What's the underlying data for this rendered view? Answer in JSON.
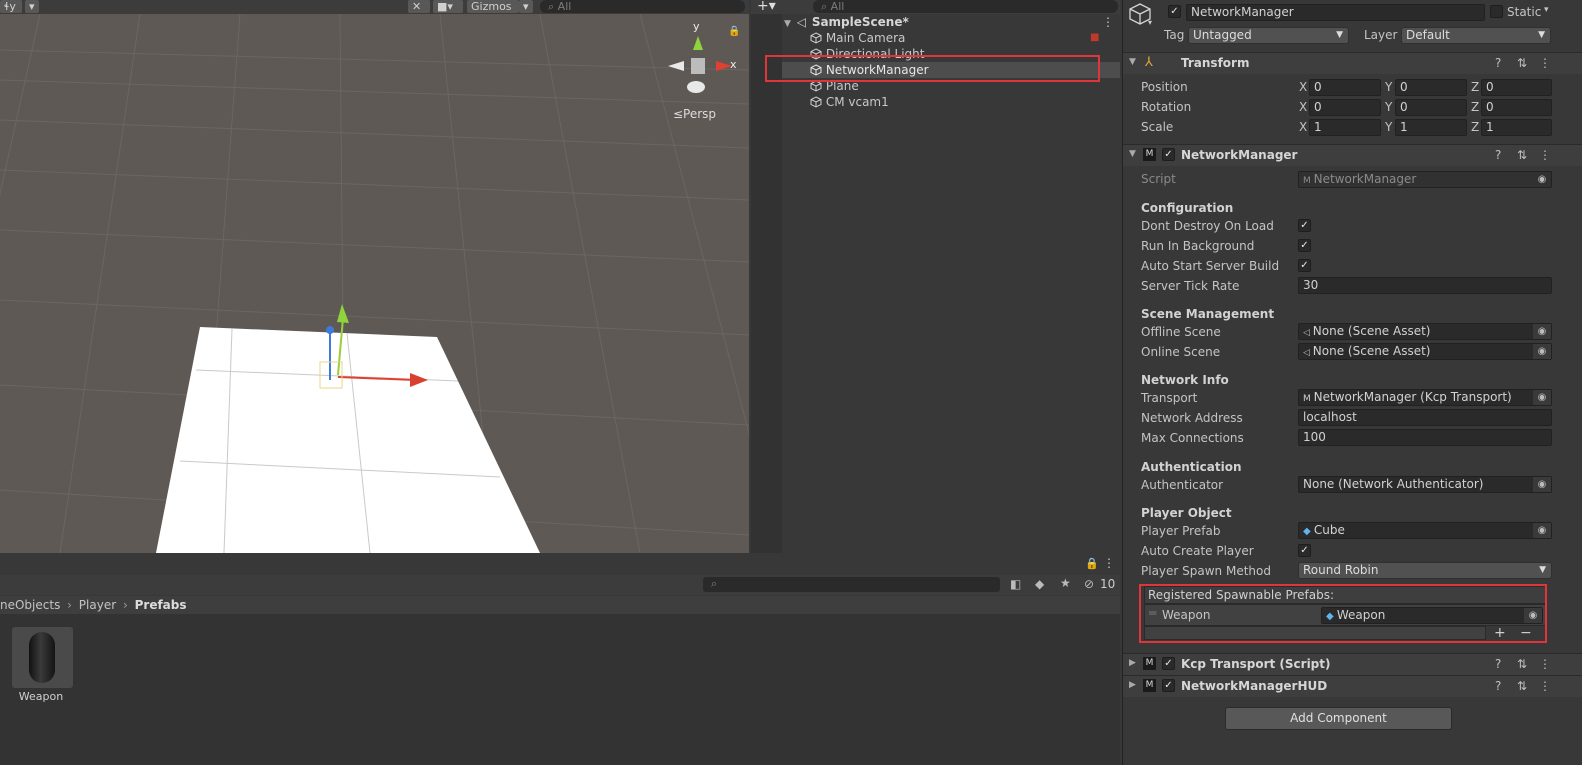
{
  "scene_view": {
    "toolbar": {
      "left_btn": "ɬy",
      "gizmos_label": "Gizmos",
      "search_placeholder": "All"
    },
    "gizmo_axes": {
      "y": "y",
      "x": "x"
    },
    "persp_label": "≤Persp"
  },
  "hierarchy": {
    "search_placeholder": "All",
    "scene_name": "SampleScene*",
    "items": [
      {
        "label": "Main Camera"
      },
      {
        "label": "Directional Light"
      },
      {
        "label": "NetworkManager"
      },
      {
        "label": "Plane"
      },
      {
        "label": "CM vcam1"
      }
    ]
  },
  "project": {
    "breadcrumb": {
      "part1": "neObjects",
      "part2": "Player",
      "part3": "Prefabs"
    },
    "hidden_count": "10",
    "assets": [
      {
        "label": "Weapon"
      }
    ]
  },
  "inspector": {
    "object_name": "NetworkManager",
    "static_label": "Static",
    "tag_label": "Tag",
    "tag_value": "Untagged",
    "layer_label": "Layer",
    "layer_value": "Default",
    "transform": {
      "title": "Transform",
      "position_label": "Position",
      "rotation_label": "Rotation",
      "scale_label": "Scale",
      "position": {
        "x": "0",
        "y": "0",
        "z": "0"
      },
      "rotation": {
        "x": "0",
        "y": "0",
        "z": "0"
      },
      "scale": {
        "x": "1",
        "y": "1",
        "z": "1"
      }
    },
    "network_manager": {
      "title": "NetworkManager",
      "script_label": "Script",
      "script_value": "NetworkManager",
      "configuration": "Configuration",
      "dont_destroy": "Dont Destroy On Load",
      "run_in_bg": "Run In Background",
      "auto_start": "Auto Start Server Build",
      "tick_rate_label": "Server Tick Rate",
      "tick_rate": "30",
      "scene_mgmt": "Scene Management",
      "offline_scene_label": "Offline Scene",
      "offline_scene": "None (Scene Asset)",
      "online_scene_label": "Online Scene",
      "online_scene": "None (Scene Asset)",
      "network_info": "Network Info",
      "transport_label": "Transport",
      "transport": "NetworkManager (Kcp Transport)",
      "address_label": "Network Address",
      "address": "localhost",
      "max_conn_label": "Max Connections",
      "max_conn": "100",
      "authentication": "Authentication",
      "authenticator_label": "Authenticator",
      "authenticator": "None (Network Authenticator)",
      "player_object": "Player Object",
      "player_prefab_label": "Player Prefab",
      "player_prefab": "Cube",
      "auto_create_label": "Auto Create Player",
      "spawn_method_label": "Player Spawn Method",
      "spawn_method": "Round Robin",
      "registered_label": "Registered Spawnable Prefabs:",
      "registered_items": [
        {
          "label": "Weapon",
          "value": "Weapon"
        }
      ]
    },
    "kcp_title": "Kcp Transport (Script)",
    "hud_title": "NetworkManagerHUD",
    "add_component": "Add Component"
  },
  "colors": {
    "highlight": "#e0353a",
    "scene_bg": "#5f5955",
    "panel_bg": "#383838"
  }
}
